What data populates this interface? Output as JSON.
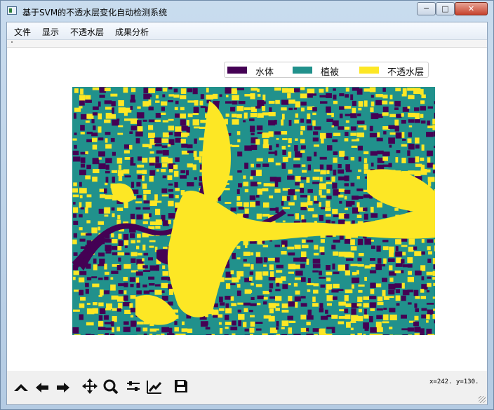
{
  "window": {
    "title": "基于SVM的不透水层变化自动检测系统",
    "minimize_glyph": "─",
    "maximize_glyph": "□",
    "close_glyph": "✕"
  },
  "menu": [
    "文件",
    "显示",
    "不透水层",
    "成果分析"
  ],
  "legend": [
    {
      "label": "水体",
      "color": "#440154"
    },
    {
      "label": "植被",
      "color": "#21918c"
    },
    {
      "label": "不透水层",
      "color": "#fde725"
    }
  ],
  "map": {
    "background_color": "#21918c"
  },
  "toolbar": {
    "icons": [
      "home-icon",
      "back-arrow-icon",
      "forward-arrow-icon",
      "pan-icon",
      "zoom-icon",
      "configure-subplots-icon",
      "edit-axis-icon",
      "save-icon"
    ],
    "coords": "x=242. y=130."
  }
}
